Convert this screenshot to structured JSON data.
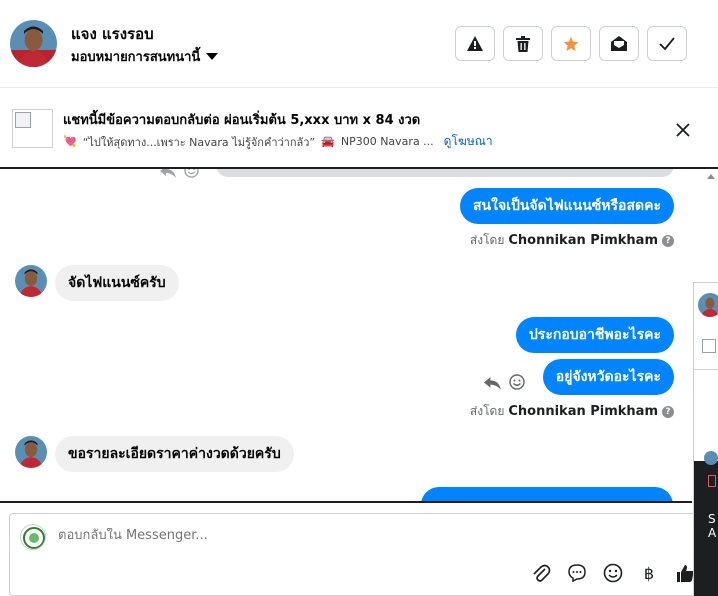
{
  "header": {
    "user_name": "แจง แรงรอบ",
    "assign_label": "มอบหมายการสนทนานี้",
    "buttons": [
      {
        "name": "report",
        "icon": "warning-icon"
      },
      {
        "name": "delete",
        "icon": "trash-icon"
      },
      {
        "name": "star",
        "icon": "star-icon",
        "color": "#f7923a"
      },
      {
        "name": "mark-unread",
        "icon": "envelope-open-icon"
      },
      {
        "name": "done",
        "icon": "check-icon"
      }
    ]
  },
  "ad": {
    "title": "แชทนี้มีข้อความตอบกลับต่อ ผ่อนเริ่มต้น 5,xxx บาท x 84 งวด",
    "subtitle_prefix": "💘",
    "subtitle": "“ไปให้สุดทาง...เพราะ Navara ไม่รู้จักคำว่ากลัว”",
    "subtitle_car": "🚘",
    "subtitle_model": "NP300 Navara ...",
    "link": "ดูโฆษณา"
  },
  "messages": [
    {
      "side": "out",
      "text": "สนใจเป็นจัดไฟแนนซ์หรือสดคะ"
    },
    {
      "side": "meta",
      "prefix": "ส่งโดย",
      "sender": "Chonnikan Pimkham"
    },
    {
      "side": "in",
      "text": "จัดไฟแนนซ์ครับ"
    },
    {
      "side": "out",
      "text": "ประกอบอาชีพอะไรคะ"
    },
    {
      "side": "out",
      "text": "อยู่จังหวัดอะไรคะ"
    },
    {
      "side": "meta",
      "prefix": "ส่งโดย",
      "sender": "Chonnikan Pimkham"
    },
    {
      "side": "in",
      "text": "ขอรายละเอียดราคาค่างวดด้วยครับ"
    }
  ],
  "composer": {
    "placeholder": "ตอบกลับใน Messenger...",
    "icons": [
      "paperclip-icon",
      "chat-bubble-icon",
      "emoji-icon",
      "baht-icon",
      "thumbs-up-icon"
    ],
    "baht_symbol": "฿"
  },
  "colors": {
    "accent": "#0084ff",
    "incoming_bubble": "#f0f0f0",
    "star": "#f7923a"
  }
}
